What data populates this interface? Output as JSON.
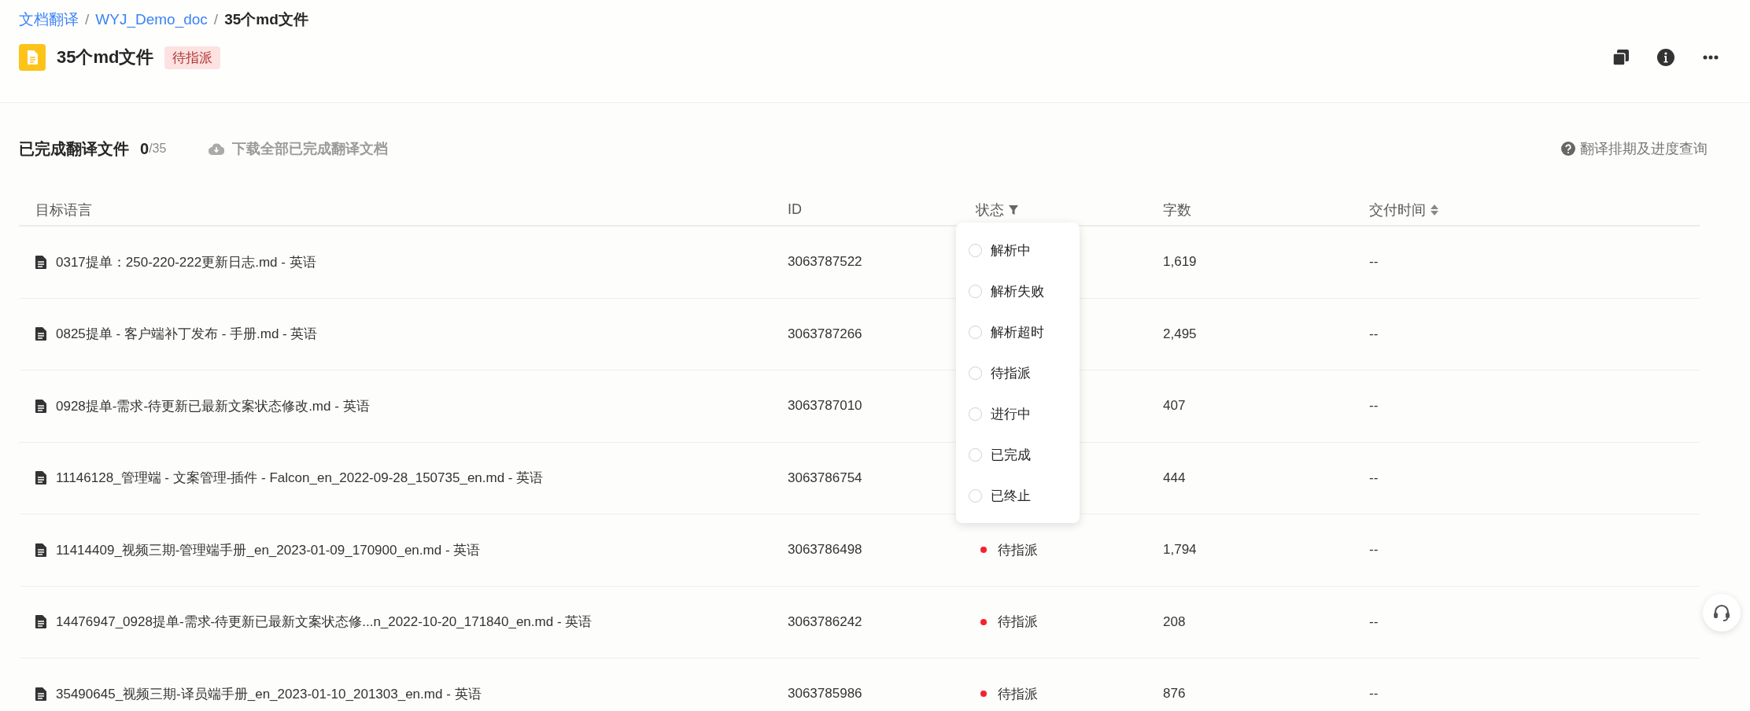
{
  "breadcrumb": [
    {
      "label": "文档翻译",
      "kind": "link"
    },
    {
      "label": "/",
      "kind": "separator"
    },
    {
      "label": "WYJ_Demo_doc",
      "kind": "link"
    },
    {
      "label": "/",
      "kind": "separator"
    },
    {
      "label": "35个md文件",
      "kind": "current"
    }
  ],
  "title": {
    "text": "35个md文件",
    "badge": "待指派"
  },
  "section": {
    "title": "已完成翻译文件",
    "done": "0",
    "total": "/35",
    "download": "下载全部已完成翻译文档",
    "help": "翻译排期及进度查询"
  },
  "table": {
    "columns": [
      {
        "label": "目标语言",
        "kind": "plain"
      },
      {
        "label": "ID",
        "kind": "plain"
      },
      {
        "label": "状态",
        "kind": "filter"
      },
      {
        "label": "字数",
        "kind": "plain"
      },
      {
        "label": "交付时间",
        "kind": "sort"
      }
    ],
    "rows": [
      {
        "name": "0317提单：250-220-222更新日志.md - 英语",
        "id": "3063787522",
        "count": "1,619",
        "delivery": "--"
      },
      {
        "name": "0825提单 - 客户端补丁发布 - 手册.md - 英语",
        "id": "3063787266",
        "count": "2,495",
        "delivery": "--"
      },
      {
        "name": "0928提单-需求-待更新已最新文案状态修改.md - 英语",
        "id": "3063787010",
        "count": "407",
        "delivery": "--"
      },
      {
        "name": "11146128_管理端 - 文案管理-插件 - Falcon_en_2022-09-28_150735_en.md - 英语",
        "id": "3063786754",
        "count": "444",
        "delivery": "--"
      },
      {
        "name": "11414409_视频三期-管理端手册_en_2023-01-09_170900_en.md - 英语",
        "id": "3063786498",
        "status": "待指派",
        "color": "#f5222d",
        "count": "1,794",
        "delivery": "--"
      },
      {
        "name": "14476947_0928提单-需求-待更新已最新文案状态修...n_2022-10-20_171840_en.md - 英语",
        "id": "3063786242",
        "status": "待指派",
        "color": "#f5222d",
        "count": "208",
        "delivery": "--"
      },
      {
        "name": "35490645_视频三期-译员端手册_en_2023-01-10_201303_en.md - 英语",
        "id": "3063785986",
        "status": "待指派",
        "color": "#f5222d",
        "count": "876",
        "delivery": "--"
      }
    ]
  },
  "status_filter": {
    "options": [
      {
        "label": "解析中",
        "selected": false
      },
      {
        "label": "解析失败",
        "selected": false
      },
      {
        "label": "解析超时",
        "selected": false
      },
      {
        "label": "待指派",
        "selected": false
      },
      {
        "label": "进行中",
        "selected": false
      },
      {
        "label": "已完成",
        "selected": false
      },
      {
        "label": "已终止",
        "selected": false
      }
    ]
  }
}
